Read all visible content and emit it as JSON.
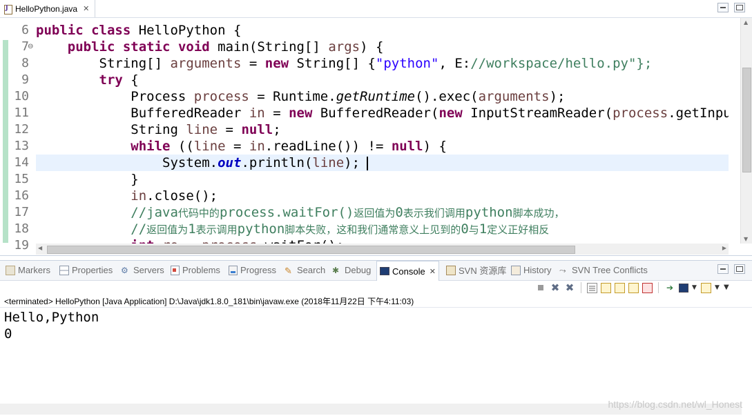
{
  "editor": {
    "tab_title": "HelloPython.java",
    "close_glyph": "✕",
    "gutter": {
      "line_numbers": [
        "6",
        "7",
        "8",
        "9",
        "10",
        "11",
        "12",
        "13",
        "14",
        "15",
        "16",
        "17",
        "18",
        "19"
      ],
      "fold_glyph": "⊖"
    },
    "code_lines": [
      "public class HelloPython {",
      "    public static void main(String[] args) {",
      "        String[] arguments = new String[] {\"python\", \"E://workspace/hello.py\"};",
      "        try {",
      "            Process process = Runtime.getRuntime().exec(arguments);",
      "            BufferedReader in = new BufferedReader(new InputStreamReader(process.getInputStream()));",
      "            String line = null;",
      "            while ((line = in.readLine()) != null) {",
      "                System.out.println(line);",
      "            }",
      "            in.close();",
      "            //java代码中的process.waitFor()返回值为0表示我们调用python脚本成功，",
      "            //返回值为1表示调用python脚本失败，这和我们通常意义上见到的0与1定义正好相反",
      "            int re = process.waitFor();"
    ]
  },
  "panel": {
    "tabs": [
      {
        "label": "Markers",
        "icon": "markers-icon"
      },
      {
        "label": "Properties",
        "icon": "properties-icon"
      },
      {
        "label": "Servers",
        "icon": "servers-icon"
      },
      {
        "label": "Problems",
        "icon": "problems-icon"
      },
      {
        "label": "Progress",
        "icon": "progress-icon"
      },
      {
        "label": "Search",
        "icon": "search-icon"
      },
      {
        "label": "Debug",
        "icon": "debug-icon"
      },
      {
        "label": "Console",
        "icon": "console-icon",
        "active": true
      },
      {
        "label": "SVN 资源库",
        "icon": "svn-repository-icon"
      },
      {
        "label": "History",
        "icon": "history-icon"
      },
      {
        "label": "SVN Tree Conflicts",
        "icon": "svn-tree-conflicts-icon"
      }
    ],
    "console_close_glyph": "✕",
    "launch_info": "<terminated> HelloPython [Java Application] D:\\Java\\jdk1.8.0_181\\bin\\javaw.exe (2018年11月22日 下午4:11:03)",
    "output_lines": [
      "Hello,Python",
      "0"
    ],
    "watermark": "https://blog.csdn.net/wl_Honest"
  },
  "colors": {
    "keyword": "#7f0055",
    "string": "#2a00ff",
    "comment": "#3f7f5f",
    "static_field": "#0000c0",
    "local_variable": "#6a3e3e",
    "current_line": "#e8f2fe",
    "change_bar": "#b6e2c8"
  }
}
